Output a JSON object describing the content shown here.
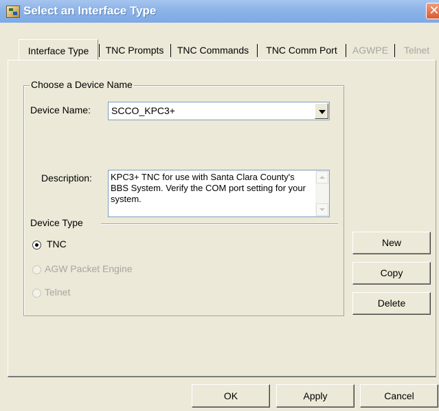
{
  "window": {
    "title": "Select an Interface Type",
    "close_glyph": "✕"
  },
  "tabs": [
    {
      "label": "Interface Type",
      "enabled": true,
      "selected": true
    },
    {
      "label": "TNC Prompts",
      "enabled": true,
      "selected": false
    },
    {
      "label": "TNC Commands",
      "enabled": true,
      "selected": false
    },
    {
      "label": "TNC Comm Port",
      "enabled": true,
      "selected": false
    },
    {
      "label": "AGWPE",
      "enabled": false,
      "selected": false
    },
    {
      "label": "Telnet",
      "enabled": false,
      "selected": false
    }
  ],
  "device_group": {
    "legend": "Choose a Device Name",
    "device_name_label": "Device Name:",
    "device_name_value": "SCCO_KPC3+",
    "description_label": "Description:",
    "description_text": "KPC3+ TNC for use with Santa Clara County's BBS System. Verify the COM port setting for your system.",
    "device_type_label": "Device Type"
  },
  "device_types": [
    {
      "label": "TNC",
      "selected": true,
      "enabled": true
    },
    {
      "label": "AGW Packet Engine",
      "selected": false,
      "enabled": false
    },
    {
      "label": "Telnet",
      "selected": false,
      "enabled": false
    }
  ],
  "side_buttons": {
    "new": "New",
    "copy": "Copy",
    "delete": "Delete"
  },
  "footer_buttons": {
    "ok": "OK",
    "apply": "Apply",
    "cancel": "Cancel"
  },
  "colors": {
    "dialog_bg": "#ece9d8",
    "title_bar": "#8eb5ea",
    "close_button": "#d85c33",
    "disabled_text": "#a7a6a0"
  },
  "icons": [
    "app-icon",
    "close-icon",
    "chevron-down-icon",
    "scroll-up-icon",
    "scroll-down-icon"
  ]
}
